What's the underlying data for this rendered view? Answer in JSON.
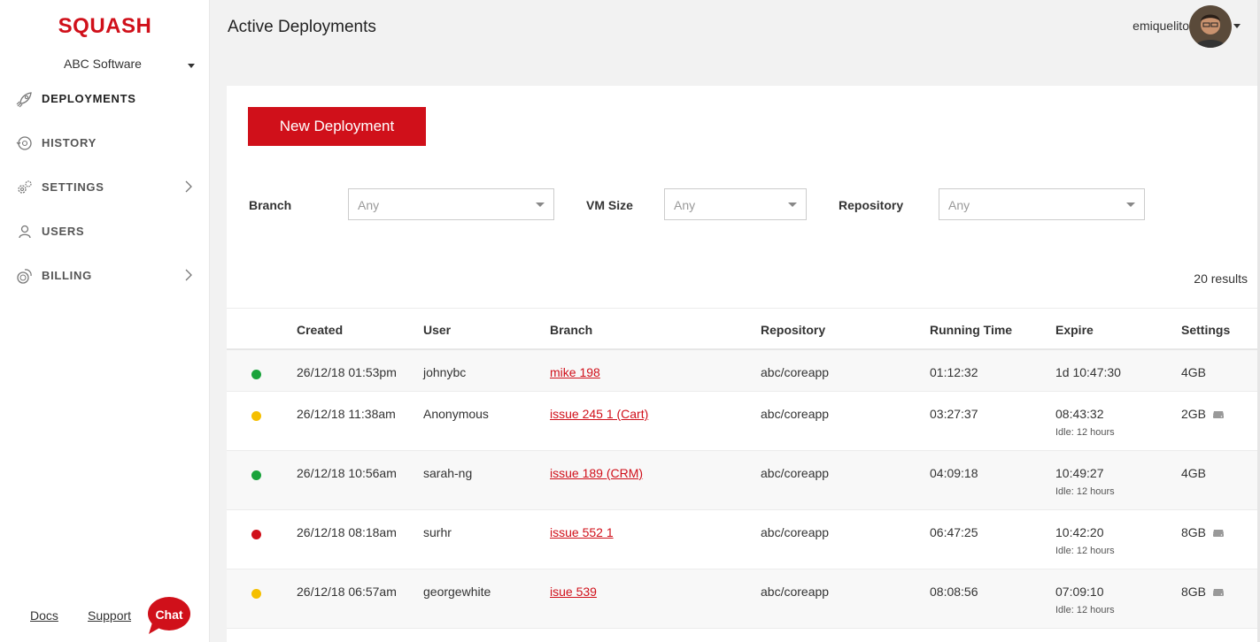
{
  "app": {
    "logo": "SQUASH",
    "org": "ABC Software"
  },
  "nav": [
    {
      "label": "DEPLOYMENTS",
      "icon": "rocket-icon",
      "active": true,
      "chevron": false
    },
    {
      "label": "HISTORY",
      "icon": "history-icon",
      "active": false,
      "chevron": false
    },
    {
      "label": "SETTINGS",
      "icon": "gears-icon",
      "active": false,
      "chevron": true
    },
    {
      "label": "USERS",
      "icon": "user-icon",
      "active": false,
      "chevron": false
    },
    {
      "label": "BILLING",
      "icon": "coins-icon",
      "active": false,
      "chevron": true
    }
  ],
  "footer": {
    "docs": "Docs",
    "support": "Support",
    "chat": "Chat"
  },
  "header": {
    "title": "Active Deployments",
    "username": "emiquelito"
  },
  "toolbar": {
    "new_deployment": "New Deployment"
  },
  "filters": {
    "branch": {
      "label": "Branch",
      "value": "Any"
    },
    "vm_size": {
      "label": "VM Size",
      "value": "Any"
    },
    "repository": {
      "label": "Repository",
      "value": "Any"
    }
  },
  "results": "20 results",
  "table": {
    "columns": [
      "Created",
      "User",
      "Branch",
      "Repository",
      "Running Time",
      "Expire",
      "Settings"
    ],
    "rows": [
      {
        "status": "green",
        "created": "26/12/18 01:53pm",
        "user": "johnybc",
        "branch": "mike 198",
        "repository": "abc/coreapp",
        "running": "01:12:32",
        "expire": "1d 10:47:30",
        "idle": "",
        "settings": "4GB",
        "drive_icon": false
      },
      {
        "status": "yellow",
        "created": "26/12/18 11:38am",
        "user": "Anonymous",
        "branch": "issue 245 1 (Cart)",
        "repository": "abc/coreapp",
        "running": "03:27:37",
        "expire": "08:43:32",
        "idle": "Idle: 12 hours",
        "settings": "2GB",
        "drive_icon": true
      },
      {
        "status": "green",
        "created": "26/12/18 10:56am",
        "user": "sarah-ng",
        "branch": "issue 189 (CRM)",
        "repository": "abc/coreapp",
        "running": "04:09:18",
        "expire": "10:49:27",
        "idle": "Idle: 12 hours",
        "settings": "4GB",
        "drive_icon": false
      },
      {
        "status": "red",
        "created": "26/12/18 08:18am",
        "user": "surhr",
        "branch": "issue 552 1",
        "repository": "abc/coreapp",
        "running": "06:47:25",
        "expire": "10:42:20",
        "idle": "Idle: 12 hours",
        "settings": "8GB",
        "drive_icon": true
      },
      {
        "status": "yellow",
        "created": "26/12/18 06:57am",
        "user": "georgewhite",
        "branch": "isue 539",
        "repository": "abc/coreapp",
        "running": "08:08:56",
        "expire": "07:09:10",
        "idle": "Idle: 12 hours",
        "settings": "8GB",
        "drive_icon": true
      }
    ]
  },
  "colors": {
    "brand": "#d0101a",
    "green": "#1aa33b",
    "yellow": "#f5bf00",
    "red": "#d0101a"
  }
}
